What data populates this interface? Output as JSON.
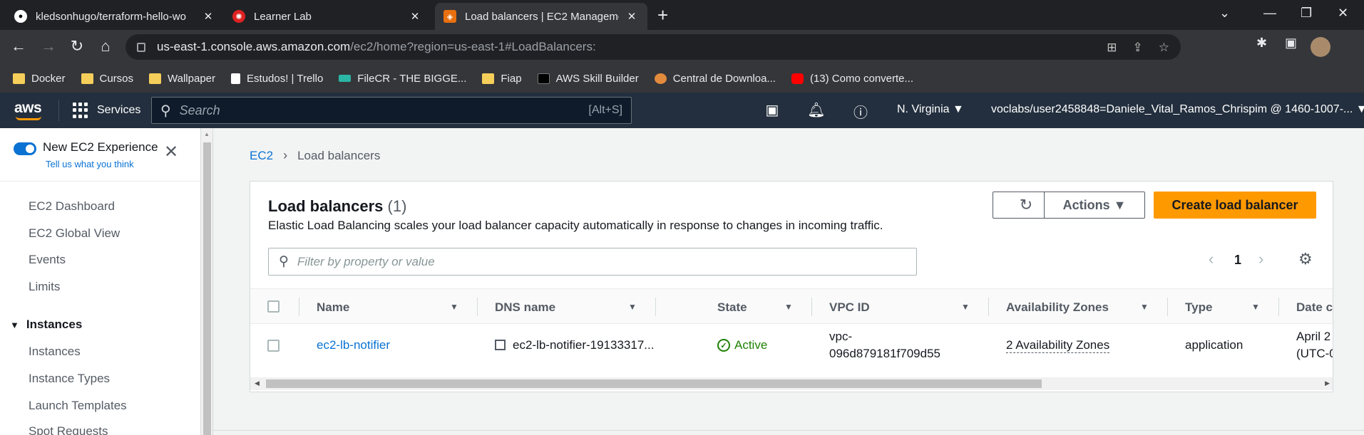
{
  "browser": {
    "tabs": [
      {
        "title": "kledsonhugo/terraform-hello-wo",
        "icon": "github-icon",
        "active": false
      },
      {
        "title": "Learner Lab",
        "icon": "canvas-icon",
        "active": false
      },
      {
        "title": "Load balancers | EC2 Managemen",
        "icon": "aws-ec2-icon",
        "active": true
      }
    ],
    "url_host": "us-east-1.console.aws.amazon.com",
    "url_path": "/ec2/home?region=us-east-1#LoadBalancers:",
    "bookmarks": [
      {
        "label": "Docker",
        "type": "folder"
      },
      {
        "label": "Cursos",
        "type": "folder"
      },
      {
        "label": "Wallpaper",
        "type": "folder"
      },
      {
        "label": "Estudos! | Trello",
        "type": "trello"
      },
      {
        "label": "FileCR - THE BIGGE...",
        "type": "filecr"
      },
      {
        "label": "Fiap",
        "type": "folder"
      },
      {
        "label": "AWS Skill Builder",
        "type": "aws"
      },
      {
        "label": "Central de Downloa...",
        "type": "globe"
      },
      {
        "label": "(13) Como converte...",
        "type": "youtube"
      }
    ]
  },
  "aws_header": {
    "logo": "aws",
    "services_label": "Services",
    "search_placeholder": "Search",
    "search_shortcut": "[Alt+S]",
    "region": "N. Virginia ▼",
    "account": "voclabs/user2458848=Daniele_Vital_Ramos_Chrispim @ 1460-1007-... ▼"
  },
  "sidebar": {
    "new_experience_label": "New EC2 Experience",
    "tell_us_link": "Tell us what you think",
    "toggle_on": true,
    "items": [
      {
        "label": "EC2 Dashboard"
      },
      {
        "label": "EC2 Global View"
      },
      {
        "label": "Events"
      },
      {
        "label": "Limits"
      }
    ],
    "section_instances": "Instances",
    "instances_items": [
      {
        "label": "Instances"
      },
      {
        "label": "Instance Types"
      },
      {
        "label": "Launch Templates"
      },
      {
        "label": "Spot Requests"
      }
    ]
  },
  "breadcrumb": {
    "root": "EC2",
    "current": "Load balancers"
  },
  "panel": {
    "title": "Load balancers",
    "count": "(1)",
    "description": "Elastic Load Balancing scales your load balancer capacity automatically in response to changes in incoming traffic.",
    "actions_label": "Actions ▼",
    "create_label": "Create load balancer",
    "filter_placeholder": "Filter by property or value",
    "page_number": "1",
    "columns": [
      "Name",
      "DNS name",
      "State",
      "VPC ID",
      "Availability Zones",
      "Type",
      "Date c"
    ],
    "rows": [
      {
        "name": "ec2-lb-notifier",
        "dns": "ec2-lb-notifier-19133317...",
        "state": "Active",
        "vpc_line1": "vpc-",
        "vpc_line2": "096d879181f709d55",
        "az": "2 Availability Zones",
        "type": "application",
        "date_line1": "April 2",
        "date_line2": "(UTC-0"
      }
    ]
  },
  "colors": {
    "aws_header": "#232f3e",
    "primary_button": "#ff9900",
    "link": "#0972d3",
    "active_status": "#1d8102"
  }
}
